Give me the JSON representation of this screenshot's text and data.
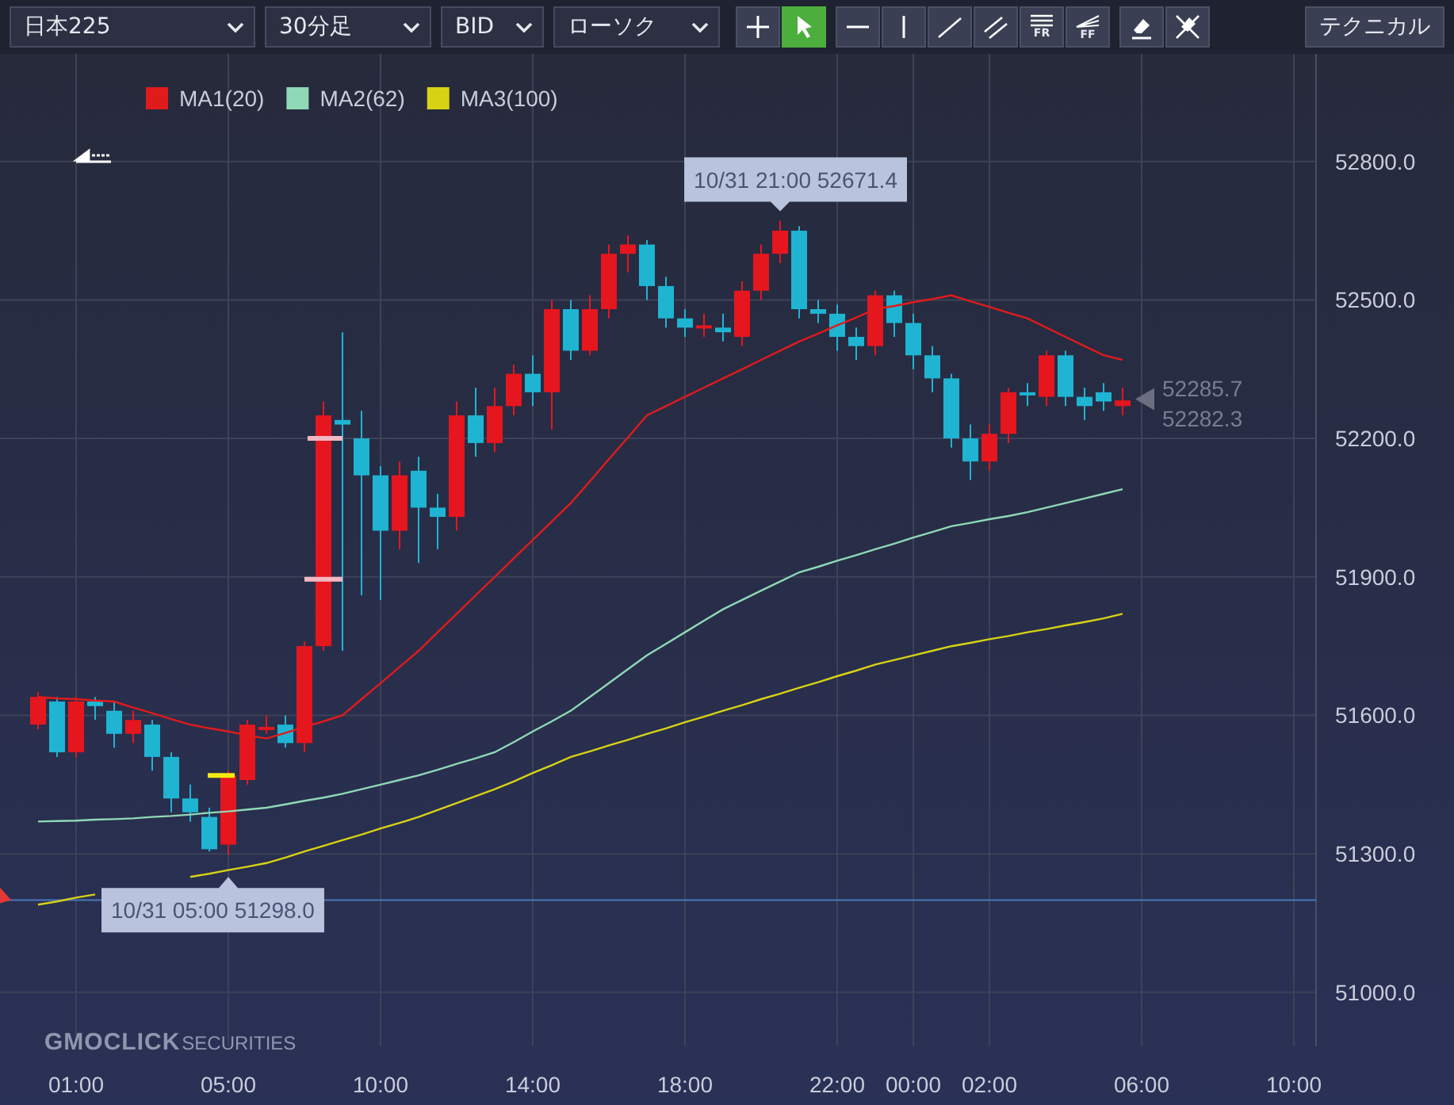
{
  "toolbar": {
    "dropdowns": [
      {
        "value": "日本225"
      },
      {
        "value": "30分足"
      },
      {
        "value": "BID"
      },
      {
        "value": "ローソク"
      }
    ],
    "tool_groups": [
      [
        {
          "kind": "crosshair",
          "selected": false
        },
        {
          "kind": "pointer",
          "selected": true
        }
      ],
      [
        {
          "kind": "hline",
          "selected": false
        },
        {
          "kind": "vline",
          "selected": false
        },
        {
          "kind": "trendline",
          "selected": false
        },
        {
          "kind": "channel",
          "selected": false
        },
        {
          "kind": "fibo-retracement",
          "label": "FR",
          "selected": false
        },
        {
          "kind": "fibo-fan",
          "label": "FF",
          "selected": false
        }
      ],
      [
        {
          "kind": "eraser",
          "selected": false
        },
        {
          "kind": "clear-all",
          "selected": false
        }
      ]
    ],
    "technical_button": "テクニカル"
  },
  "chart": {
    "chart_data": {
      "type": "candlestick",
      "categories": [
        null,
        null,
        "01:00",
        null,
        null,
        null,
        null,
        null,
        null,
        null,
        "05:00",
        null,
        null,
        null,
        null,
        null,
        null,
        null,
        "10:00",
        null,
        null,
        null,
        null,
        null,
        null,
        null,
        "14:00",
        null,
        null,
        null,
        null,
        null,
        null,
        null,
        "18:00",
        null,
        null,
        null,
        null,
        null,
        null,
        null,
        "22:00",
        null,
        null,
        null,
        "00:00",
        null,
        null,
        null,
        "02:00",
        null,
        null,
        null,
        null,
        null,
        null,
        null,
        "06:00",
        null,
        null,
        null,
        null,
        null,
        null,
        null,
        "10:00"
      ],
      "ohlc": [
        [
          51580,
          51650,
          51570,
          51640
        ],
        [
          51630,
          51640,
          51510,
          51520
        ],
        [
          51520,
          51640,
          51510,
          51630
        ],
        [
          51630,
          51640,
          51590,
          51620
        ],
        [
          51610,
          51630,
          51530,
          51560
        ],
        [
          51560,
          51610,
          51540,
          51590
        ],
        [
          51580,
          51590,
          51480,
          51510
        ],
        [
          51510,
          51520,
          51390,
          51420
        ],
        [
          51420,
          51450,
          51370,
          51390
        ],
        [
          51380,
          51400,
          51305,
          51310
        ],
        [
          51320,
          51480,
          51298,
          51470
        ],
        [
          51460,
          51590,
          51450,
          51580
        ],
        [
          51570,
          51600,
          51560,
          51575
        ],
        [
          51580,
          51600,
          51530,
          51540
        ],
        [
          51540,
          51760,
          51520,
          51750
        ],
        [
          51750,
          52280,
          51740,
          52250
        ],
        [
          52240,
          52430,
          51740,
          52230
        ],
        [
          52200,
          52260,
          51860,
          52120
        ],
        [
          52120,
          52140,
          51850,
          52000
        ],
        [
          52000,
          52150,
          51960,
          52120
        ],
        [
          52130,
          52160,
          51930,
          52050
        ],
        [
          52050,
          52080,
          51960,
          52030
        ],
        [
          52030,
          52280,
          52000,
          52250
        ],
        [
          52250,
          52310,
          52160,
          52190
        ],
        [
          52190,
          52310,
          52170,
          52270
        ],
        [
          52270,
          52360,
          52250,
          52340
        ],
        [
          52340,
          52380,
          52270,
          52300
        ],
        [
          52300,
          52500,
          52220,
          52480
        ],
        [
          52480,
          52500,
          52370,
          52390
        ],
        [
          52390,
          52510,
          52380,
          52480
        ],
        [
          52480,
          52620,
          52460,
          52600
        ],
        [
          52600,
          52640,
          52560,
          52620
        ],
        [
          52620,
          52630,
          52500,
          52530
        ],
        [
          52530,
          52550,
          52440,
          52460
        ],
        [
          52460,
          52480,
          52420,
          52440
        ],
        [
          52440,
          52470,
          52420,
          52445
        ],
        [
          52440,
          52470,
          52410,
          52430
        ],
        [
          52420,
          52540,
          52400,
          52520
        ],
        [
          52520,
          52620,
          52500,
          52600
        ],
        [
          52600,
          52671.4,
          52580,
          52650
        ],
        [
          52650,
          52660,
          52460,
          52480
        ],
        [
          52480,
          52500,
          52450,
          52470
        ],
        [
          52470,
          52490,
          52390,
          52420
        ],
        [
          52420,
          52440,
          52370,
          52400
        ],
        [
          52400,
          52520,
          52380,
          52510
        ],
        [
          52510,
          52520,
          52420,
          52450
        ],
        [
          52450,
          52470,
          52350,
          52380
        ],
        [
          52380,
          52400,
          52300,
          52330
        ],
        [
          52330,
          52340,
          52180,
          52200
        ],
        [
          52200,
          52230,
          52110,
          52150
        ],
        [
          52150,
          52230,
          52130,
          52210
        ],
        [
          52210,
          52310,
          52190,
          52300
        ],
        [
          52300,
          52320,
          52270,
          52295
        ],
        [
          52290,
          52390,
          52270,
          52380
        ],
        [
          52380,
          52390,
          52270,
          52290
        ],
        [
          52290,
          52310,
          52240,
          52270
        ],
        [
          52300,
          52320,
          52260,
          52280
        ],
        [
          52270,
          52310,
          52250,
          52282.3
        ],
        null,
        null,
        null,
        null,
        null,
        null,
        null,
        null,
        null
      ],
      "series": [
        {
          "name": "MA1(20)",
          "type": "line",
          "color": "#e01b1b",
          "values": [
            51640,
            51637,
            51635,
            51632,
            51630,
            51617,
            51605,
            51592,
            51580,
            51572,
            51565,
            51557,
            51550,
            51562,
            51575,
            51587,
            51600,
            51635,
            51670,
            51705,
            51740,
            51780,
            51820,
            51860,
            51900,
            51940,
            51980,
            52020,
            52060,
            52107,
            52155,
            52202,
            52250,
            52270,
            52290,
            52310,
            52330,
            52350,
            52370,
            52390,
            52410,
            52427,
            52445,
            52462,
            52480,
            52487,
            52495,
            52502,
            52510,
            52497,
            52485,
            52472,
            52460,
            52440,
            52420,
            52400,
            52380,
            52370,
            null,
            null,
            null,
            null,
            null,
            null,
            null,
            null,
            null
          ]
        },
        {
          "name": "MA2(62)",
          "type": "line",
          "color": "#8fd9b6",
          "values": [
            51370,
            51371,
            51372,
            51374,
            51375,
            51377,
            51380,
            51382,
            51385,
            51389,
            51392,
            51396,
            51400,
            51407,
            51415,
            51422,
            51430,
            51440,
            51450,
            51460,
            51470,
            51482,
            51495,
            51507,
            51520,
            51542,
            51565,
            51587,
            51610,
            51640,
            51670,
            51700,
            51730,
            51755,
            51780,
            51805,
            51830,
            51850,
            51870,
            51890,
            51910,
            51922,
            51935,
            51947,
            51960,
            51972,
            51985,
            51997,
            52010,
            52017,
            52025,
            52032,
            52040,
            52050,
            52060,
            52070,
            52080,
            52090,
            null,
            null,
            null,
            null,
            null,
            null,
            null,
            null,
            null
          ]
        },
        {
          "name": "MA3(100)",
          "type": "line",
          "color": "#d8d215",
          "values": [
            51190,
            51197,
            51205,
            51212,
            null,
            null,
            null,
            null,
            51250,
            51257,
            51265,
            51272,
            51280,
            51292,
            51305,
            51317,
            51330,
            51342,
            51355,
            51367,
            51380,
            51395,
            51410,
            51425,
            51440,
            51457,
            51475,
            51492,
            51510,
            51522,
            51535,
            51547,
            51560,
            51572,
            51585,
            51597,
            51610,
            51622,
            51635,
            51647,
            51660,
            51672,
            51685,
            51697,
            51710,
            51720,
            51730,
            51740,
            51750,
            51757,
            51765,
            51772,
            51780,
            51787,
            51795,
            51802,
            51810,
            51820,
            null,
            null,
            null,
            null,
            null,
            null,
            null,
            null,
            null
          ]
        }
      ],
      "ylim": [
        50883,
        53033
      ],
      "yticks": [
        {
          "value": 51000,
          "label": "51000.0"
        },
        {
          "value": 51300,
          "label": "51300.0"
        },
        {
          "value": 51600,
          "label": "51600.0"
        },
        {
          "value": 51900,
          "label": "51900.0"
        },
        {
          "value": 52200,
          "label": "52200.0"
        },
        {
          "value": 52500,
          "label": "52500.0"
        },
        {
          "value": 52800,
          "label": "52800.0"
        }
      ],
      "grid": true,
      "ref_lines": [
        {
          "axis": "y",
          "value": 51200,
          "color": "#4b78b8"
        }
      ],
      "legend": "upper left",
      "annotations": [
        {
          "text": "10/31 21:00 52671.4",
          "y": 52671.4
        },
        {
          "text": "10/31 05:00 51298.0",
          "y": 51298
        }
      ]
    },
    "price_labels": [
      "52285.7",
      "52282.3"
    ],
    "logo": {
      "brand": "GMOCLICK",
      "suffix": "SECURITIES"
    }
  }
}
